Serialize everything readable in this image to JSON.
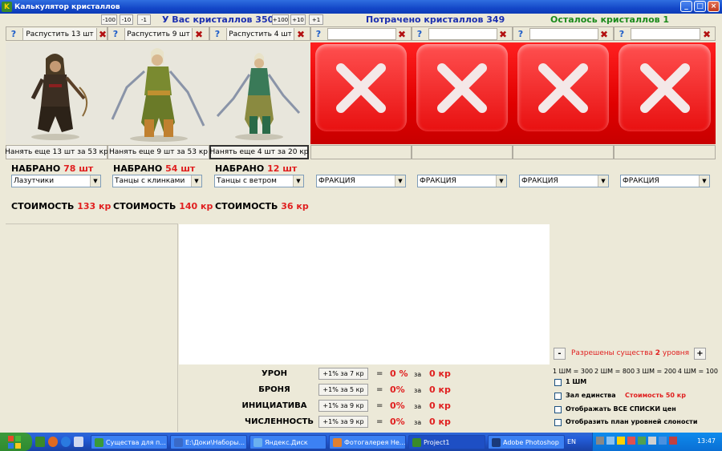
{
  "window": {
    "title": "Калькулятор кристаллов",
    "app_icon": "K"
  },
  "window_controls": {
    "minimize": "_",
    "maximize": "□",
    "close": "×"
  },
  "adjust_left": [
    "-100",
    "-10",
    "-1"
  ],
  "adjust_right": [
    "+100",
    "+10",
    "+1"
  ],
  "crystals": {
    "have_label": "У Вас кристаллов 350",
    "spent_label": "Потрачено кристаллов 349",
    "left_label": "Осталось кристаллов 1"
  },
  "slots": [
    {
      "help": "?",
      "dismiss": "Распустить 13 шт",
      "close": "✖",
      "hire": "Нанять еще 13 шт за 53 кр",
      "count_label": "НАБРАНО",
      "count": "78 шт",
      "faction": "Лазутчики",
      "cost_label": "СТОИМОСТЬ",
      "cost": "133 кр"
    },
    {
      "help": "?",
      "dismiss": "Распустить 9 шт",
      "close": "✖",
      "hire": "Нанять еще 9 шт за 53 кр",
      "count_label": "НАБРАНО",
      "count": "54 шт",
      "faction": "Танцы с клинками",
      "cost_label": "СТОИМОСТЬ",
      "cost": "140 кр"
    },
    {
      "help": "?",
      "dismiss": "Распустить 4 шт",
      "close": "✖",
      "hire": "Нанять еще 4 шт за 20 кр",
      "count_label": "НАБРАНО",
      "count": "12 шт",
      "faction": "Танцы с ветром",
      "cost_label": "СТОИМОСТЬ",
      "cost": "36 кр"
    },
    {
      "help": "?",
      "close": "✖",
      "faction": "ФРАКЦИЯ"
    },
    {
      "help": "?",
      "close": "✖",
      "faction": "ФРАКЦИЯ"
    },
    {
      "help": "?",
      "close": "✖",
      "faction": "ФРАКЦИЯ"
    },
    {
      "help": "?",
      "close": "✖",
      "faction": "ФРАКЦИЯ"
    }
  ],
  "stats": [
    {
      "label": "УРОН",
      "button": "+1% за 7 кр",
      "eq": "=",
      "pct": "0 %",
      "za": "за",
      "cost": "0 кр"
    },
    {
      "label": "БРОНЯ",
      "button": "+1% за 5 кр",
      "eq": "=",
      "pct": "0%",
      "za": "за",
      "cost": "0 кр"
    },
    {
      "label": "ИНИЦИАТИВА",
      "button": "+1% за 9 кр",
      "eq": "=",
      "pct": "0%",
      "za": "за",
      "cost": "0 кр"
    },
    {
      "label": "ЧИСЛЕННОСТЬ",
      "button": "+1% за 9 кр",
      "eq": "=",
      "pct": "0%",
      "za": "за",
      "cost": "0 кр"
    }
  ],
  "level": {
    "minus": "-",
    "text": "Разрешены существа",
    "value": "2",
    "suffix": "уровня",
    "plus": "+"
  },
  "sm_rates": [
    "1 ШМ = 300",
    "2 ШМ = 800",
    "3 ШМ = 200",
    "4 ШМ = 100"
  ],
  "options": {
    "sm1": "1 ШМ",
    "unity": "Зал единства",
    "unity_cost": "Стоимость 50 кр",
    "show_all": "Отображать ВСЕ СПИСКИ цен",
    "show_plan": "Отобразить план уровней слоности"
  },
  "dropdown_arrow": "▼",
  "taskbar": {
    "tasks": [
      {
        "label": "Существа для п...",
        "color": "#3a9a3a"
      },
      {
        "label": "E:\\Доки\\Наборы...",
        "color": "#3a6ac8"
      },
      {
        "label": "Яндекс.Диск",
        "color": "#6ab0f0"
      },
      {
        "label": "Фотогалерея Не...",
        "color": "#e08030"
      },
      {
        "label": "Project1",
        "color": "#3a8a2a"
      },
      {
        "label": "Adobe Photoshop",
        "color": "#1a3a7a"
      }
    ],
    "lang": "EN",
    "clock": "13:47"
  }
}
